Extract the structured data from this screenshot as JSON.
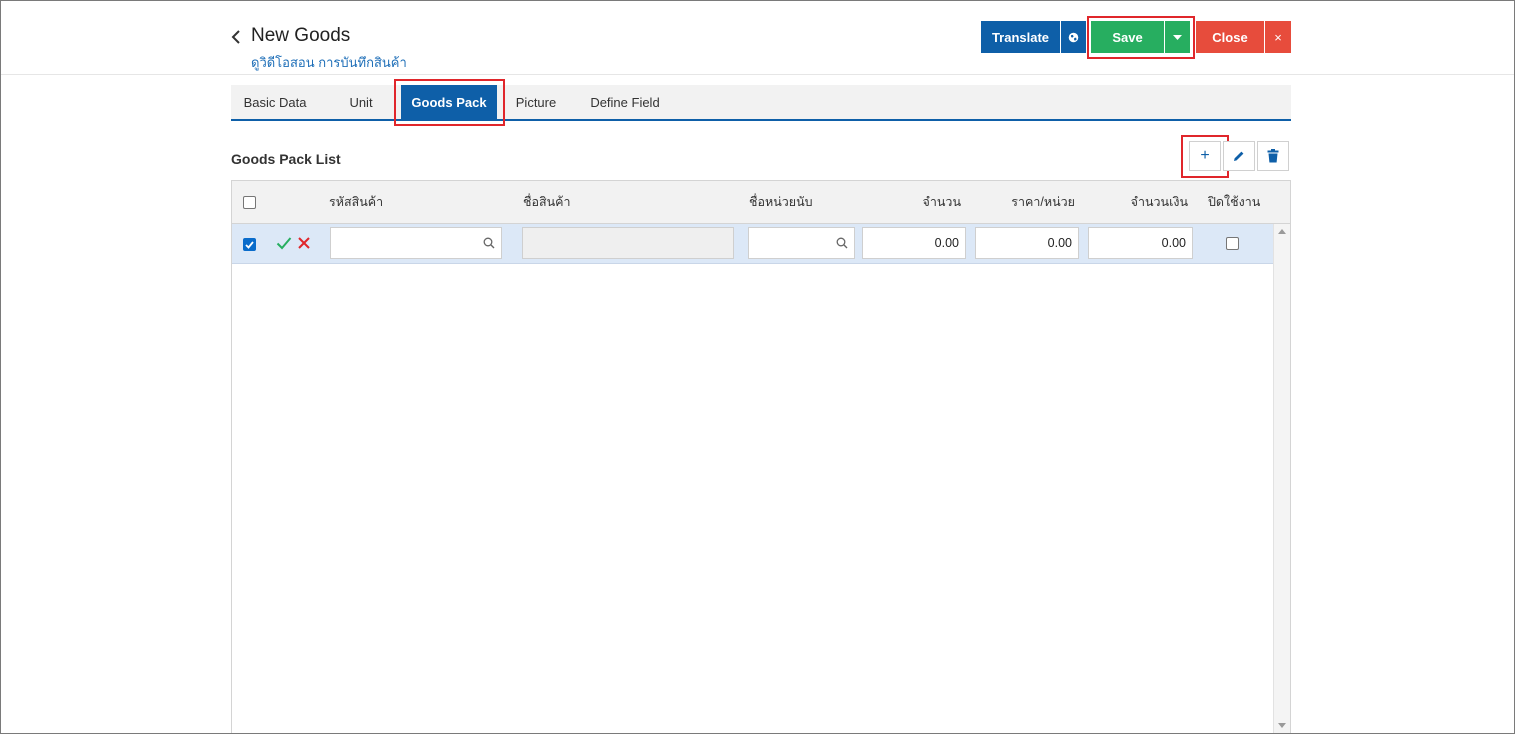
{
  "header": {
    "title": "New Goods",
    "subtitle_link": "ดูวิดีโอสอน การบันทึกสินค้า"
  },
  "actions": {
    "translate_label": "Translate",
    "save_label": "Save",
    "close_label": "Close",
    "close_x": "×"
  },
  "tabs": [
    {
      "label": "Basic Data",
      "active": false
    },
    {
      "label": "Unit",
      "active": false
    },
    {
      "label": "Goods Pack",
      "active": true
    },
    {
      "label": "Picture",
      "active": false
    },
    {
      "label": "Define Field",
      "active": false
    }
  ],
  "section": {
    "title": "Goods Pack List",
    "add_label": "+"
  },
  "grid": {
    "columns": [
      "รหัสสินค้า",
      "ชื่อสินค้า",
      "ชื่อหน่วยนับ",
      "จำนวน",
      "ราคา/หน่วย",
      "จำนวนเงิน",
      "ปิดใช้งาน"
    ],
    "rows": [
      {
        "selected": true,
        "goods_code": "",
        "goods_name": "",
        "unit_name": "",
        "quantity": "0.00",
        "unit_price": "0.00",
        "amount": "0.00",
        "disabled": false
      }
    ]
  },
  "colors": {
    "primary": "#0e5fa8",
    "success": "#27ae60",
    "danger": "#e74c3c",
    "highlight": "#e0262b",
    "row_selected": "#dce8f7"
  },
  "icons": {
    "back": "chevron-left-icon",
    "globe": "globe-icon",
    "dropdown": "caret-down-icon",
    "edit": "pencil-icon",
    "delete": "trash-icon",
    "confirm": "check-icon",
    "cancel": "x-icon",
    "search": "search-icon"
  }
}
